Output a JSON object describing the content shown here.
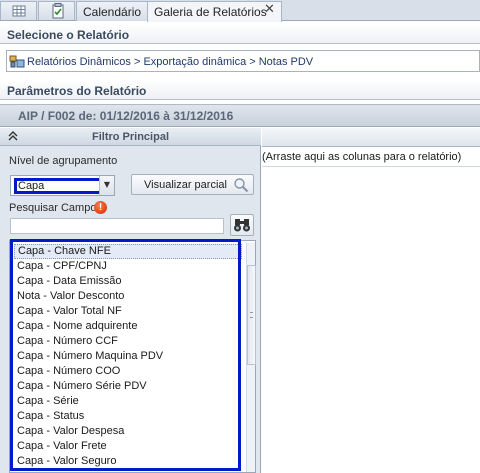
{
  "tabs": {
    "calendar_label": "Calendário",
    "gallery_label": "Galeria de Relatórios",
    "close_glyph": "✕"
  },
  "selecione": {
    "title": "Selecione o Relatório",
    "path": "Relatórios Dinâmicos > Exportação dinâmica > Notas PDV"
  },
  "parametros": {
    "title": "Parâmetros do Relatório"
  },
  "aip": {
    "label": "AIP / F002 de: 01/12/2016 à 31/12/2016"
  },
  "filtro": {
    "title": "Filtro Principal",
    "nivel_label": "Nível de agrupamento",
    "nivel_value": "Capa",
    "visualizar_label": "Visualizar parcial",
    "pesquisar_label": "Pesquisar Campo",
    "search_value": "",
    "items": [
      "Capa - Chave NFE",
      "Capa - CPF/CPNJ",
      "Capa - Data Emissão",
      "Nota - Valor Desconto",
      "Capa - Valor Total NF",
      "Capa - Nome adquirente",
      "Capa - Número CCF",
      "Capa - Número Maquina PDV",
      "Capa - Número COO",
      "Capa - Número Série PDV",
      "Capa - Série",
      "Capa - Status",
      "Capa - Valor Despesa",
      "Capa - Valor Frete",
      "Capa - Valor Seguro"
    ]
  },
  "grid": {
    "drop_hint": "(Arraste aqui as colunas para o relatório)"
  },
  "colors": {
    "highlight": "#0019c9",
    "header_text": "#3a4a60",
    "panel_bg": "#dfe6ee"
  }
}
